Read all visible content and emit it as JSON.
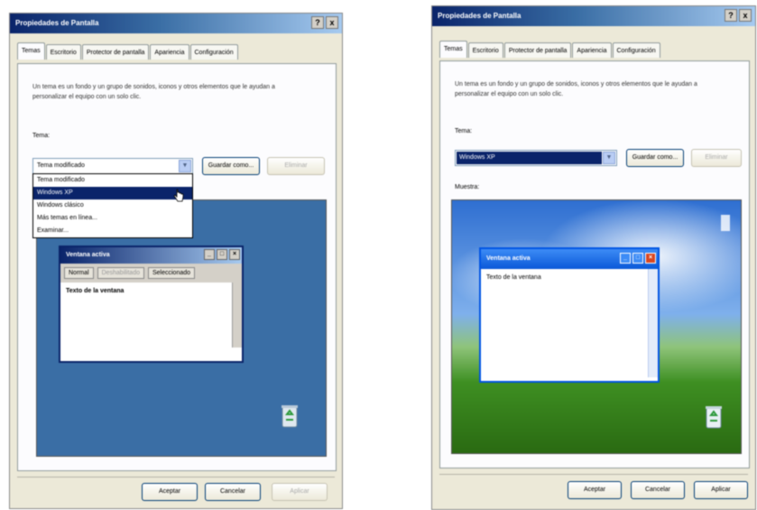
{
  "left": {
    "title": "Propiedades de Pantalla",
    "title_buttons": [
      "?",
      "x"
    ],
    "tabs": [
      "Temas",
      "Escritorio",
      "Protector de pantalla",
      "Apariencia",
      "Configuración"
    ],
    "description": "Un tema es un fondo y un grupo de sonidos, iconos y otros elementos que le ayudan a personalizar el equipo con un solo clic.",
    "theme_label": "Tema:",
    "theme_value": "Tema modificado",
    "save_button": "Guardar como...",
    "delete_button": "Eliminar",
    "dropdown_items": [
      "Tema modificado",
      "Windows XP",
      "Windows clásico",
      "Más temas en línea...",
      "Examinar..."
    ],
    "dropdown_highlighted_index": 1,
    "preview_window": {
      "title": "Ventana activa",
      "tabs": [
        "Normal",
        "Deshabilitado",
        "Seleccionado"
      ],
      "text": "Texto de la ventana"
    },
    "buttons": {
      "ok": "Aceptar",
      "cancel": "Cancelar",
      "apply": "Aplicar"
    }
  },
  "right": {
    "title": "Propiedades de Pantalla",
    "title_buttons": [
      "?",
      "x"
    ],
    "tabs": [
      "Temas",
      "Escritorio",
      "Protector de pantalla",
      "Apariencia",
      "Configuración"
    ],
    "description": "Un tema es un fondo y un grupo de sonidos, iconos y otros elementos que le ayudan a personalizar el equipo con un solo clic.",
    "theme_label": "Tema:",
    "theme_value": "Windows XP",
    "save_button": "Guardar como...",
    "delete_button": "Eliminar",
    "preview_label": "Muestra:",
    "preview_window": {
      "title": "Ventana activa",
      "text": "Texto de la ventana"
    },
    "buttons": {
      "ok": "Aceptar",
      "cancel": "Cancelar",
      "apply": "Aplicar"
    }
  }
}
